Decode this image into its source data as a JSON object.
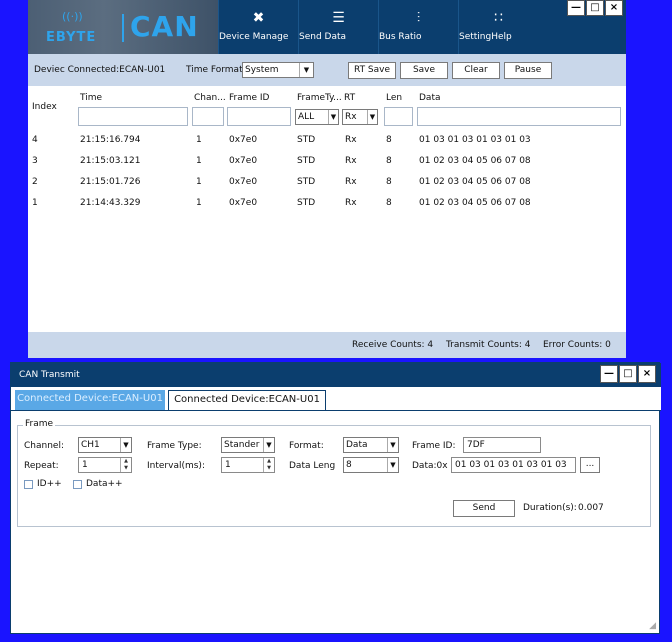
{
  "main": {
    "logo": {
      "brand": "EBYTE",
      "product": "CAN"
    },
    "nav": [
      {
        "label": "Device Manage",
        "icon": "tools-icon",
        "glyph": "✖"
      },
      {
        "label": "Send Data",
        "icon": "list-icon",
        "glyph": "☰"
      },
      {
        "label": "Bus Ratio",
        "icon": "sliders-icon",
        "glyph": "⫶"
      },
      {
        "label": "SettingHelp",
        "icon": "settings-grid-icon",
        "glyph": "∷"
      }
    ],
    "window_controls": {
      "minimize": "—",
      "maximize": "□",
      "close": "×"
    },
    "toolbar": {
      "connected": "Deviec Connected:ECAN-U01",
      "time_format_label": "Time Format",
      "time_format_value": "System",
      "rt_save": "RT Save",
      "save": "Save",
      "clear": "Clear",
      "pause": "Pause"
    },
    "grid": {
      "headers": {
        "index": "Index",
        "time": "Time",
        "channel": "Chan...",
        "frame_id": "Frame ID",
        "frame_type": "FrameTy...",
        "rt": "RT",
        "len": "Len",
        "data": "Data"
      },
      "filters": {
        "frame_type": "ALL",
        "rt": "Rx"
      },
      "rows": [
        {
          "index": "4",
          "time": "21:15:16.794",
          "channel": "1",
          "frame_id": "0x7e0",
          "frame_type": "STD",
          "rt": "Rx",
          "len": "8",
          "data": "01 03 01 03 01 03 01 03"
        },
        {
          "index": "3",
          "time": "21:15:03.121",
          "channel": "1",
          "frame_id": "0x7e0",
          "frame_type": "STD",
          "rt": "Rx",
          "len": "8",
          "data": "01 02 03 04 05 06 07 08"
        },
        {
          "index": "2",
          "time": "21:15:01.726",
          "channel": "1",
          "frame_id": "0x7e0",
          "frame_type": "STD",
          "rt": "Rx",
          "len": "8",
          "data": "01 02 03 04 05 06 07 08"
        },
        {
          "index": "1",
          "time": "21:14:43.329",
          "channel": "1",
          "frame_id": "0x7e0",
          "frame_type": "STD",
          "rt": "Rx",
          "len": "8",
          "data": "01 02 03 04 05 06 07 08"
        }
      ]
    },
    "status": {
      "receive": "Receive Counts:  4",
      "transmit": "Transmit Counts:  4",
      "error": "Error Counts:  0"
    }
  },
  "transmit": {
    "title": "CAN Transmit",
    "window_controls": {
      "minimize": "—",
      "maximize": "□",
      "close": "×"
    },
    "tabs": [
      "Connected Device:ECAN-U01",
      "Connected Device:ECAN-U01"
    ],
    "frame": {
      "legend": "Frame",
      "channel_label": "Channel:",
      "channel_value": "CH1",
      "frame_type_label": "Frame Type:",
      "frame_type_value": "Stander",
      "format_label": "Format:",
      "format_value": "Data",
      "frame_id_label": "Frame ID:",
      "frame_id_value": "7DF",
      "repeat_label": "Repeat:",
      "repeat_value": "1",
      "interval_label": "Interval(ms):",
      "interval_value": "1",
      "data_len_label": "Data Leng",
      "data_len_value": "8",
      "data_label": "Data:0x",
      "data_value": "01 03 01 03 01 03 01 03",
      "browse": "...",
      "id_inc": "ID++",
      "data_inc": "Data++"
    },
    "send": "Send",
    "duration_label": "Duration(s):",
    "duration_value": "0.007"
  }
}
